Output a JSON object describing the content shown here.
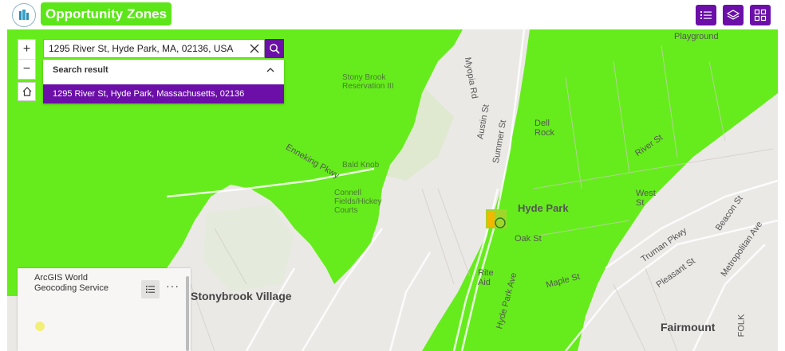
{
  "header": {
    "title": "Opportunity Zones",
    "buttons": [
      "list-icon",
      "layers-icon",
      "grid-icon"
    ]
  },
  "colors": {
    "accent": "#6b0fa8",
    "zone_green": "#66ec1c",
    "title_green": "#5ce619"
  },
  "search": {
    "value": "1295 River St, Hyde Park, MA, 02136, USA",
    "results_header": "Search result",
    "result": "1295 River St, Hyde Park, Massachusetts, 02136"
  },
  "controls": {
    "zoom_in": "+",
    "zoom_out": "−"
  },
  "legend": {
    "title": "ArcGIS World Geocoding Service",
    "more": "···"
  },
  "map_labels": {
    "stonybrook_village": "Stonybrook Village",
    "hyde_park": "Hyde Park",
    "fairmount": "Fairmount",
    "bald_knob": "Bald Knob",
    "connell": "Connell Fields/Hickey Courts",
    "stony_brook": "Stony Brook Reservation III",
    "enneking": "Enneking Pkwy",
    "summer": "Summer St",
    "austin": "Austin St",
    "myopia": "Myopia Rd",
    "river": "River St",
    "truman": "Truman Pkwy",
    "pleasant": "Pleasant St",
    "dell_rock": "Dell Rock",
    "oak": "Oak St",
    "rite_aid": "Rite Aid",
    "maple": "Maple St",
    "hyde_park_ave": "Hyde Park Ave",
    "west": "West St",
    "folk": "FOLK",
    "playground": "Playground",
    "metropolitan": "Metropolitan Ave",
    "beacon": "Beacon St"
  }
}
